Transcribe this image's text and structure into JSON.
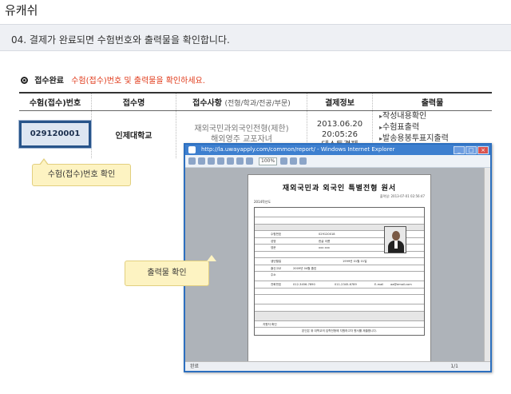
{
  "app_title": "유캐쉬",
  "step": {
    "label": "04. 결제가 완료되면 수험번호와 출력물을 확인합니다."
  },
  "section": {
    "label": "접수완료",
    "description": "수험(접수)번호 및 출력물을 확인하세요."
  },
  "table": {
    "headers": {
      "reg_no": "수험(접수)번호",
      "school": "접수명",
      "details": "접수사항",
      "details_sub": "(전형/학과/전공/부문)",
      "payment": "결제정보",
      "output": "출력물"
    },
    "row": {
      "reg_no": "029120001",
      "school": "인제대학교",
      "details_1": "재외국민과외국인전형(제한)",
      "details_2": "해외영주 교포자녀",
      "pay_date": "2013.06.20",
      "pay_time": "20:05:26",
      "pay_method": "테스트결제",
      "outputs": [
        "작성내용확인",
        "수험표출력",
        "발송용봉투표지출력"
      ]
    }
  },
  "callouts": {
    "reg_no": "수험(접수)번호 확인",
    "output": "출력물 확인"
  },
  "ie_window": {
    "title": "http://la.uwayapply.com/common/report/ - Windows Internet Explorer",
    "zoom": "100%",
    "status_left": "완료",
    "status_right": "1/1"
  },
  "document": {
    "title": "재외국민과 외국인 특별전형 원서",
    "print_date": "출력일: 2013-07-01 02:56:47",
    "year_label": "2014학년도",
    "reg_no_label": "수험번호",
    "reg_no_value": "029120018",
    "name_label": "성명",
    "name_value": "한글 이름",
    "name_en_label": "영문",
    "name_en_value": "xxx xxx",
    "birth_label": "생년월일",
    "birth_value": "1999년 01월 01일",
    "address_label": "주소",
    "phone_label": "전화번호",
    "phone_value": "012-3456-7890",
    "mobile_value": "011-2345-6789",
    "email_label": "E-mail",
    "email_value": "aa@email.com",
    "school_label": "출신고교",
    "school_value": "2009년 04월 졸업",
    "sign_label": "지원자 확인",
    "footer_note": "본인은 위 대학교의 입학전형에 지원하고자 원서를 제출합니다."
  }
}
